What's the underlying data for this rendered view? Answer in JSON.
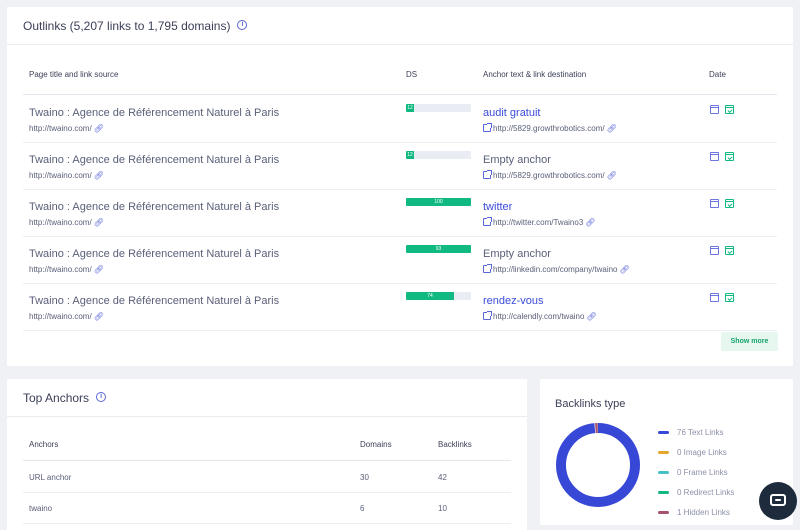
{
  "outlinks": {
    "title": "Outlinks (5,207 links to 1,795 domains)",
    "headers": {
      "source": "Page title and link source",
      "ds": "DS",
      "anchor": "Anchor text & link destination",
      "date": "Date"
    },
    "rows": [
      {
        "title": "Twaino : Agence de Référencement Naturel à Paris",
        "source": "http://twaino.com/",
        "ds": 12,
        "ds_label": "12",
        "anchor": "audit gratuit",
        "anchor_is_link": true,
        "dest": "http://5829.growthrobotics.com/"
      },
      {
        "title": "Twaino : Agence de Référencement Naturel à Paris",
        "source": "http://twaino.com/",
        "ds": 12,
        "ds_label": "12",
        "anchor": "Empty anchor",
        "anchor_is_link": false,
        "dest": "http://5829.growthrobotics.com/"
      },
      {
        "title": "Twaino : Agence de Référencement Naturel à Paris",
        "source": "http://twaino.com/",
        "ds": 100,
        "ds_label": "100",
        "anchor": "twitter",
        "anchor_is_link": true,
        "dest": "http://twitter.com/Twaino3"
      },
      {
        "title": "Twaino : Agence de Référencement Naturel à Paris",
        "source": "http://twaino.com/",
        "ds": 93,
        "ds_label": "93",
        "anchor": "Empty anchor",
        "anchor_is_link": false,
        "dest": "http://linkedin.com/company/twaino"
      },
      {
        "title": "Twaino : Agence de Référencement Naturel à Paris",
        "source": "http://twaino.com/",
        "ds": 74,
        "ds_label": "74",
        "anchor": "rendez-vous",
        "anchor_is_link": true,
        "dest": "http://calendly.com/twaino"
      }
    ],
    "show_more": "Show more"
  },
  "top_anchors": {
    "title": "Top Anchors",
    "headers": {
      "anchors": "Anchors",
      "domains": "Domains",
      "backlinks": "Backlinks"
    },
    "rows": [
      {
        "anchor": "URL anchor",
        "domains": "30",
        "backlinks": "42"
      },
      {
        "anchor": "twaino",
        "domains": "6",
        "backlinks": "10"
      }
    ]
  },
  "backlinks_type": {
    "title": "Backlinks type",
    "legend": [
      {
        "label": "76 Text Links",
        "value": 76,
        "color": "#3848d6"
      },
      {
        "label": "0 Image Links",
        "value": 0,
        "color": "#e3a82b"
      },
      {
        "label": "0 Frame Links",
        "value": 0,
        "color": "#48c1c6"
      },
      {
        "label": "0 Redirect Links",
        "value": 0,
        "color": "#10b981"
      },
      {
        "label": "1 Hidden Links",
        "value": 1,
        "color": "#a8526b"
      }
    ]
  },
  "colors": {
    "accent": "#3b4bd9",
    "ds_green": "#10b981",
    "background": "#f0f1f5"
  }
}
